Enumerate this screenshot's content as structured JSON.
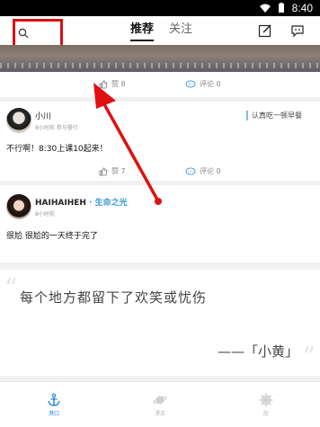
{
  "status_bar": {
    "time": "8:40"
  },
  "header": {
    "tabs": [
      {
        "label": "推荐"
      },
      {
        "label": "关注"
      }
    ]
  },
  "posts": [
    {
      "actions": {
        "like": "赞 8",
        "comment": "评论 0"
      }
    },
    {
      "user_name": "小川",
      "meta": "8小时前 参与餐行",
      "tag": "认真吃一顿早餐",
      "text": "不行啊！8:30上课10起来！",
      "actions": {
        "like": "赞 7",
        "comment": "评论 0"
      }
    },
    {
      "user_name": "HAIHAIHEH",
      "topic": "· 生命之光",
      "meta": "8小时前",
      "text": "很尬 很尬的一天终于完了"
    }
  ],
  "quote": {
    "text": "每个地方都留下了欢笑或忧伤",
    "author": "——「小黄」"
  },
  "bottom_nav": [
    {
      "label": "港口",
      "icon": "anchor-icon",
      "active": true
    },
    {
      "label": "漂流",
      "icon": "planet-icon",
      "active": false
    },
    {
      "label": "舵",
      "icon": "helm-icon",
      "active": false
    }
  ],
  "colors": {
    "accent": "#2b8fd8",
    "highlight_box": "#e01010",
    "topic": "#3a9ad8"
  }
}
